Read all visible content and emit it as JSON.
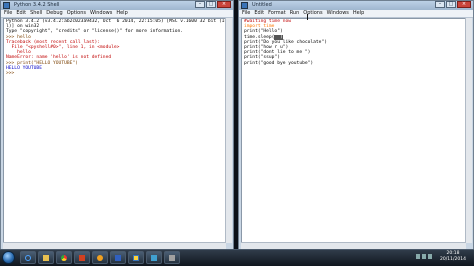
{
  "shell_window": {
    "title": "Python 3.4.2 Shell",
    "menu": [
      "File",
      "Edit",
      "Shell",
      "Debug",
      "Options",
      "Windows",
      "Help"
    ],
    "lines": [
      {
        "text": "Python 3.4.2 (v3.4.2:ab2c023a9432, Oct  6 2014, 22:15:05) [MSC v.1600 32 bit (Inte",
        "cls": ""
      },
      {
        "text": "l)] on win32",
        "cls": ""
      },
      {
        "text": "Type \"copyright\", \"credits\" or \"license()\" for more information.",
        "cls": ""
      },
      {
        "text": ">>> hello",
        "cls": "prompt"
      },
      {
        "text": "Traceback (most recent call last):",
        "cls": "err"
      },
      {
        "text": "  File \"<pyshell#0>\", line 1, in <module>",
        "cls": "err"
      },
      {
        "text": "    hello",
        "cls": "err"
      },
      {
        "text": "NameError: name 'hello' is not defined",
        "cls": "err"
      },
      {
        "text": ">>> print(\"HELLO YOUTUBE\")",
        "cls": "prompt"
      },
      {
        "text": "HELLO YOUTUBE",
        "cls": "out"
      },
      {
        "text": ">>> ",
        "cls": "prompt"
      }
    ]
  },
  "editor_window": {
    "title": "Untitled",
    "menu": [
      "File",
      "Edit",
      "Format",
      "Run",
      "Options",
      "Windows",
      "Help"
    ],
    "lines": [
      {
        "text": "#waiting time now",
        "cls": "err"
      },
      {
        "text": "",
        "cls": ""
      },
      {
        "text": "import time",
        "cls": "kw"
      },
      {
        "text": "",
        "cls": ""
      },
      {
        "text": "print(\"Hello\")",
        "cls": ""
      },
      {
        "text": "time.sleep(",
        "cls": "",
        "hl": "  )"
      },
      {
        "text": "",
        "cls": ""
      },
      {
        "text": "print(\"Do you like chocolate\")",
        "cls": ""
      },
      {
        "text": "print(\"how r u\")",
        "cls": ""
      },
      {
        "text": "print(\"dont lie to me \")",
        "cls": ""
      },
      {
        "text": "print(\"ssup\")",
        "cls": ""
      },
      {
        "text": "print(\"good bye youtube\")",
        "cls": ""
      }
    ]
  },
  "taskbar": {
    "clock_time": "20:18",
    "clock_date": "20/11/2014"
  },
  "colors": {
    "error": "#c00000",
    "output": "#0000c8",
    "string": "#008000",
    "keyword": "#ff7700",
    "builtin": "#900090"
  }
}
